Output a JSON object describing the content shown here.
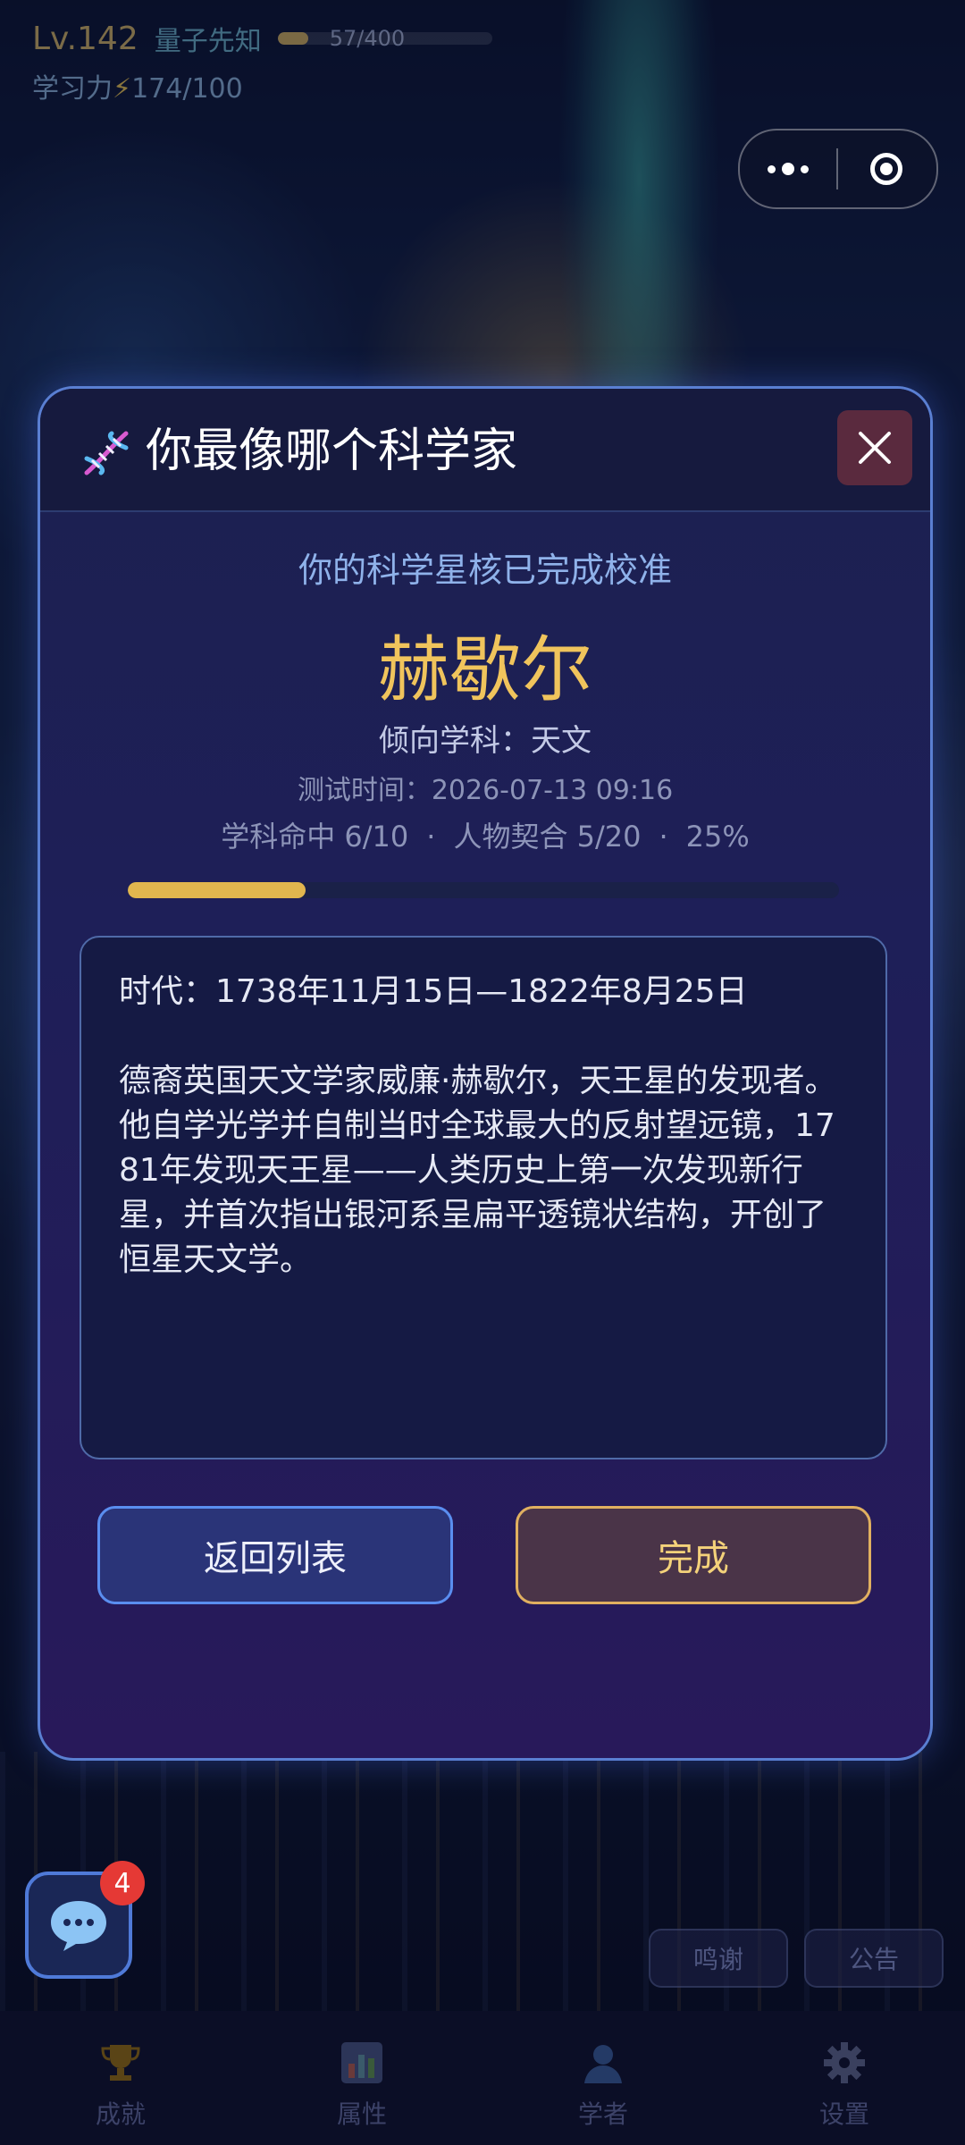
{
  "hud": {
    "level": "Lv.142",
    "rank": "量子先知",
    "xp_text": "57/400",
    "xp_progress": 0.1425,
    "study_label": "学习力",
    "study_value": "174/100"
  },
  "modal": {
    "title": "你最像哪个科学家",
    "subtitle": "你的科学星核已完成校准",
    "scientist_name": "赫歇尔",
    "subject": "倾向学科：天文",
    "test_time": "测试时间：2026-07-13 09:16",
    "stats": {
      "subject_hit": "学科命中 6/10",
      "sep": "·",
      "match": "人物契合 5/20",
      "percent": "25%"
    },
    "progress": 0.25,
    "era": "时代：1738年11月15日—1822年8月25日",
    "description": "德裔英国天文学家威廉·赫歇尔，天王星的发现者。他自学光学并自制当时全球最大的反射望远镜，1781年发现天王星——人类历史上第一次发现新行星，并首次指出银河系呈扁平透镜状结构，开创了恒星天文学。",
    "back_button": "返回列表",
    "done_button": "完成"
  },
  "chat": {
    "badge_count": "4"
  },
  "side_buttons": {
    "thanks": "鸣谢",
    "notice": "公告"
  },
  "tabs": [
    {
      "label": "成就",
      "icon": "trophy-icon"
    },
    {
      "label": "属性",
      "icon": "bar-chart-icon"
    },
    {
      "label": "学者",
      "icon": "user-icon"
    },
    {
      "label": "设置",
      "icon": "gear-icon"
    }
  ],
  "colors": {
    "accent_gold": "#f0c45c",
    "accent_blue": "#5a8ef0",
    "badge_red": "#e53935"
  }
}
